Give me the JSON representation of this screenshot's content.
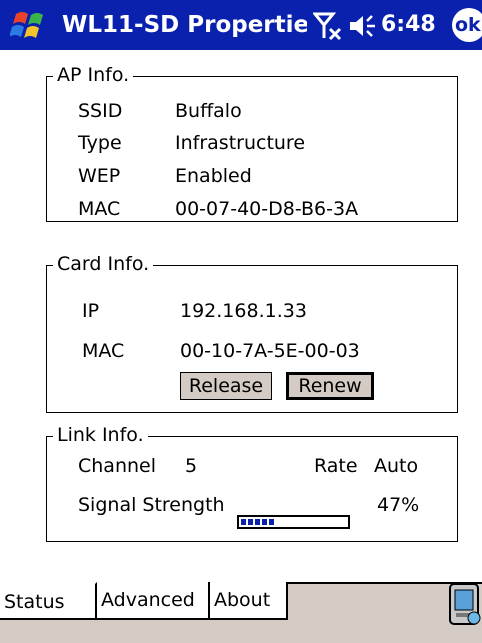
{
  "titlebar": {
    "title": "WL11-SD Propertie:",
    "time": "6:48",
    "ok_label": "ok"
  },
  "ap_info": {
    "legend": "AP Info.",
    "rows": [
      {
        "label": "SSID",
        "value": "Buffalo"
      },
      {
        "label": "Type",
        "value": "Infrastructure"
      },
      {
        "label": "WEP",
        "value": "Enabled"
      },
      {
        "label": "MAC",
        "value": "00-07-40-D8-B6-3A"
      }
    ]
  },
  "card_info": {
    "legend": "Card Info.",
    "ip_label": "IP",
    "ip_value": "192.168.1.33",
    "mac_label": "MAC",
    "mac_value": "00-10-7A-5E-00-03",
    "release_label": "Release",
    "renew_label": "Renew"
  },
  "link_info": {
    "legend": "Link Info.",
    "channel_label": "Channel",
    "channel_value": "5",
    "rate_label": "Rate",
    "rate_value": "Auto",
    "signal_label": "Signal Strength",
    "signal_percent": "47%",
    "signal_fraction": 0.47
  },
  "tabs": [
    {
      "label": "Status"
    },
    {
      "label": "Advanced"
    },
    {
      "label": "About"
    }
  ],
  "colors": {
    "titlebar": "#0a21ad",
    "button_face": "#d4ccc4",
    "signal": "#0a21ad"
  }
}
